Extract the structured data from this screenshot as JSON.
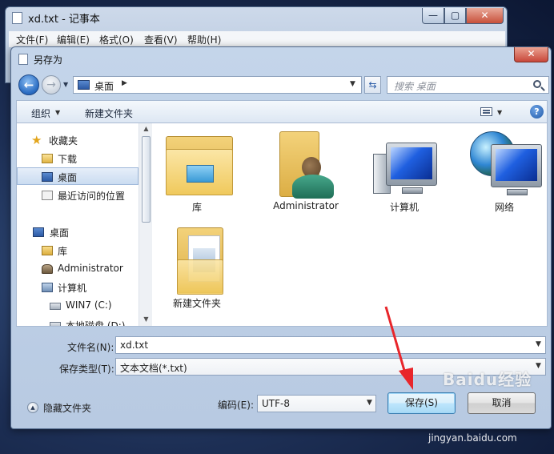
{
  "notepad": {
    "title": "xd.txt - 记事本",
    "controls": {
      "minimize": "—",
      "maximize": "▢",
      "close": "✕"
    },
    "menu": [
      "文件(F)",
      "编辑(E)",
      "格式(O)",
      "查看(V)",
      "帮助(H)"
    ]
  },
  "dialog": {
    "title": "另存为",
    "close": "✕",
    "address": {
      "location": "桌面",
      "separator": "▶"
    },
    "search": {
      "placeholder": "搜索 桌面"
    },
    "toolbar": {
      "organize": "组织",
      "organize_caret": "▼",
      "new_folder": "新建文件夹",
      "view_caret": "▼",
      "help": "?"
    },
    "nav_pane": {
      "items": [
        {
          "label": "收藏夹",
          "icon": "star-icon"
        },
        {
          "label": "下载",
          "icon": "download-folder-icon"
        },
        {
          "label": "桌面",
          "icon": "desktop-icon",
          "selected": true
        },
        {
          "label": "最近访问的位置",
          "icon": "recent-places-icon"
        },
        {
          "label": "桌面",
          "icon": "desktop-icon"
        },
        {
          "label": "库",
          "icon": "libraries-icon"
        },
        {
          "label": "Administrator",
          "icon": "user-folder-icon"
        },
        {
          "label": "计算机",
          "icon": "computer-icon"
        },
        {
          "label": "WIN7 (C:)",
          "icon": "drive-icon"
        },
        {
          "label": "本地磁盘 (D:)",
          "icon": "drive-icon"
        }
      ]
    },
    "files": [
      {
        "label": "库",
        "icon": "libraries-folder-icon"
      },
      {
        "label": "Administrator",
        "icon": "user-folder-icon"
      },
      {
        "label": "计算机",
        "icon": "computer-icon"
      },
      {
        "label": "网络",
        "icon": "network-icon"
      },
      {
        "label": "新建文件夹",
        "icon": "folder-icon"
      }
    ],
    "form": {
      "filename_label": "文件名(N):",
      "filename_value": "xd.txt",
      "type_label": "保存类型(T):",
      "type_value": "文本文档(*.txt)",
      "encoding_label": "编码(E):",
      "encoding_value": "UTF-8"
    },
    "hide_folders": "隐藏文件夹",
    "buttons": {
      "save": "保存(S)",
      "cancel": "取消"
    }
  },
  "watermark": {
    "logo": "Baidu经验",
    "url": "jingyan.baidu.com"
  },
  "colors": {
    "accent": "#3c7fb1",
    "title_bar": "#c4d5ea",
    "annotation_arrow": "#e8262b"
  }
}
